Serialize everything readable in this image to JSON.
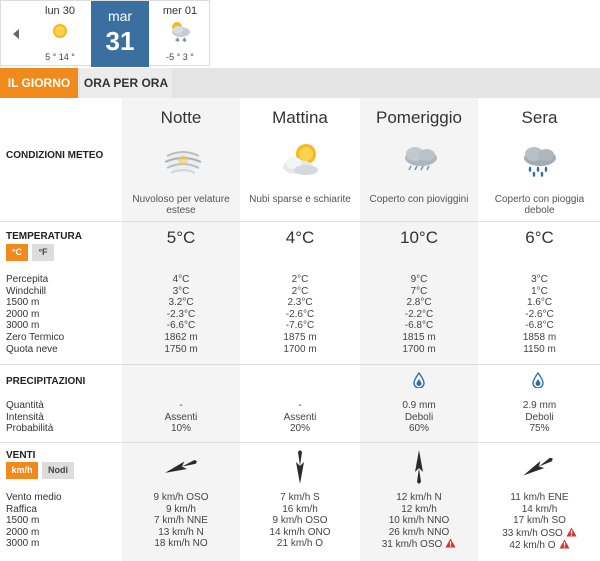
{
  "day_nav": {
    "prev_icon": "chevron-left-icon",
    "days": [
      {
        "name": "lun 30",
        "temps": "5 ° 14 °",
        "icon": "sun-icon"
      },
      {
        "name": "mar",
        "num": "31",
        "icon": ""
      },
      {
        "name": "mer 01",
        "temps": "-5 ° 3 °",
        "icon": "snow-cloud-icon"
      }
    ]
  },
  "tabs": [
    {
      "label": "IL GIORNO",
      "active": true
    },
    {
      "label": "ORA PER ORA",
      "active": false
    }
  ],
  "periods": [
    {
      "title": "Notte",
      "condition": "Nuvoloso per velature estese",
      "icon": "veiled-cloud-icon",
      "temp": "5°C",
      "temp_rows": [
        "4°C",
        "3°C",
        "3.2°C",
        "-2.3°C",
        "-6.6°C",
        "1862 m",
        "1750 m"
      ],
      "precip_icon": "",
      "precip_rows": [
        "-",
        "Assenti",
        "10%"
      ],
      "wind_icon": "wind-arrow-icon",
      "wind_rows": [
        "9 km/h  OSO",
        "9 km/h",
        "7 km/h NNE",
        "13 km/h N",
        "18 km/h NO"
      ],
      "wind_warn": [
        false,
        false,
        false,
        false,
        false
      ]
    },
    {
      "title": "Mattina",
      "condition": "Nubi sparse e schiarite",
      "icon": "partly-cloudy-icon",
      "temp": "4°C",
      "temp_rows": [
        "2°C",
        "2°C",
        "2.3°C",
        "-2.6°C",
        "-7.6°C",
        "1875 m",
        "1700 m"
      ],
      "precip_icon": "",
      "precip_rows": [
        "-",
        "Assenti",
        "20%"
      ],
      "wind_icon": "wind-arrow-icon",
      "wind_rows": [
        "7 km/h  S",
        "16 km/h",
        "9 km/h OSO",
        "14 km/h ONO",
        "21 km/h O"
      ],
      "wind_warn": [
        false,
        false,
        false,
        false,
        false
      ]
    },
    {
      "title": "Pomeriggio",
      "condition": "Coperto con pioviggini",
      "icon": "drizzle-cloud-icon",
      "temp": "10°C",
      "temp_rows": [
        "9°C",
        "7°C",
        "2.8°C",
        "-2.2°C",
        "-6.8°C",
        "1815 m",
        "1700 m"
      ],
      "precip_icon": "raindrop-icon",
      "precip_rows": [
        "0.9 mm",
        "Deboli",
        "60%"
      ],
      "wind_icon": "wind-arrow-icon",
      "wind_rows": [
        "12 km/h  N",
        "12 km/h",
        "10 km/h NNO",
        "26 km/h NNO",
        "31 km/h OSO"
      ],
      "wind_warn": [
        false,
        false,
        false,
        false,
        true
      ]
    },
    {
      "title": "Sera",
      "condition": "Coperto con pioggia debole",
      "icon": "rain-cloud-icon",
      "temp": "6°C",
      "temp_rows": [
        "3°C",
        "1°C",
        "1.6°C",
        "-2.6°C",
        "-6.8°C",
        "1858 m",
        "1150 m"
      ],
      "precip_icon": "raindrop-icon",
      "precip_rows": [
        "2.9 mm",
        "Deboli",
        "75%"
      ],
      "wind_icon": "wind-arrow-icon",
      "wind_rows": [
        "11 km/h  ENE",
        "14 km/h",
        "17 km/h SO",
        "33 km/h OSO",
        "42 km/h O"
      ],
      "wind_warn": [
        false,
        false,
        false,
        true,
        true
      ]
    }
  ],
  "sections": {
    "conditions": "CONDIZIONI METEO",
    "temperature": "TEMPERATURA",
    "unit_c": "°C",
    "unit_f": "°F",
    "temp_rows": [
      "Percepita",
      "Windchill",
      "1500 m",
      "2000 m",
      "3000 m",
      "Zero Termico",
      "Quota neve"
    ],
    "precipitation": "PRECIPITAZIONI",
    "precip_rows": [
      "Quantità",
      "Intensità",
      "Probabilità"
    ],
    "wind": "VENTI",
    "unit_kmh": "km/h",
    "unit_knots": "Nodi",
    "wind_rows": [
      "Vento medio",
      "Raffica",
      "1500 m",
      "2000 m",
      "3000 m"
    ]
  },
  "colors": {
    "accent": "#f08a1c",
    "active_day": "#3a6fa0",
    "warning": "#d9302b",
    "drop": "#2f6fa8"
  },
  "wind_directions_deg": [
    250,
    180,
    0,
    240
  ]
}
